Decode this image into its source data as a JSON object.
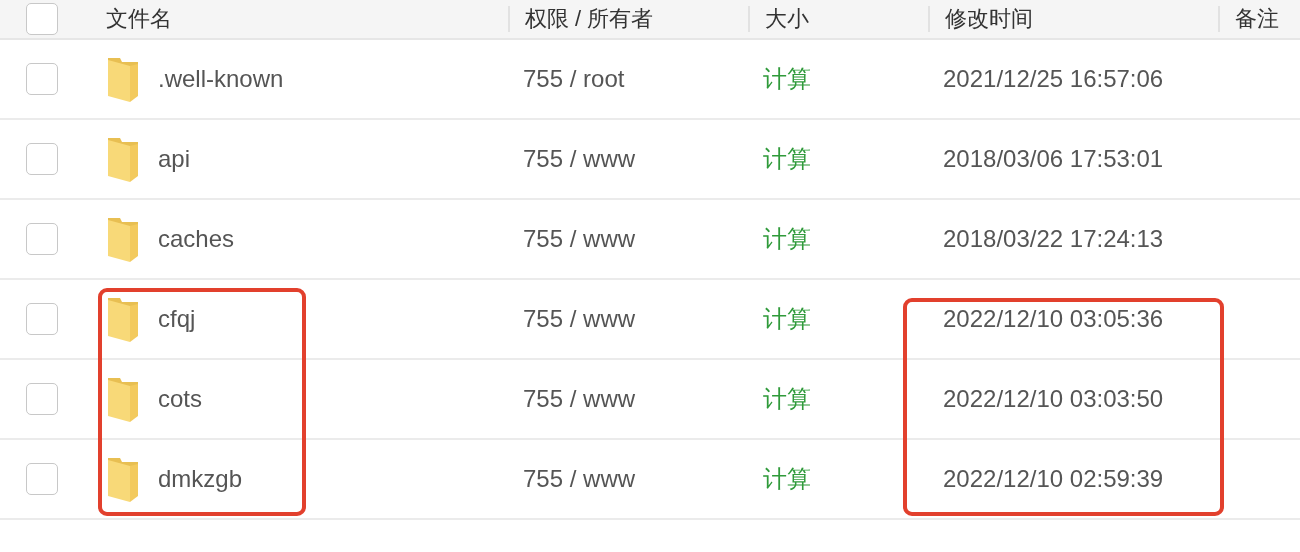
{
  "header": {
    "select_all": {
      "checked": false
    },
    "columns": [
      "文件名",
      "权限 / 所有者",
      "大小",
      "修改时间",
      "备注"
    ]
  },
  "rows": [
    {
      "checked": false,
      "name": ".well-known",
      "permission": "755 / root",
      "size": "计算",
      "modified": "2021/12/25 16:57:06",
      "name_marked": false,
      "time_marked": false
    },
    {
      "checked": false,
      "name": "api",
      "permission": "755 / www",
      "size": "计算",
      "modified": "2018/03/06 17:53:01",
      "name_marked": false,
      "time_marked": false
    },
    {
      "checked": false,
      "name": "caches",
      "permission": "755 / www",
      "size": "计算",
      "modified": "2018/03/22 17:24:13",
      "name_marked": false,
      "time_marked": false
    },
    {
      "checked": false,
      "name": "cfqj",
      "permission": "755 / www",
      "size": "计算",
      "modified": "2022/12/10 03:05:36",
      "name_marked": true,
      "time_marked": true
    },
    {
      "checked": false,
      "name": "cots",
      "permission": "755 / www",
      "size": "计算",
      "modified": "2022/12/10 03:03:50",
      "name_marked": true,
      "time_marked": true
    },
    {
      "checked": false,
      "name": "dmkzgb",
      "permission": "755 / www",
      "size": "计算",
      "modified": "2022/12/10 02:59:39",
      "name_marked": true,
      "time_marked": true
    }
  ]
}
